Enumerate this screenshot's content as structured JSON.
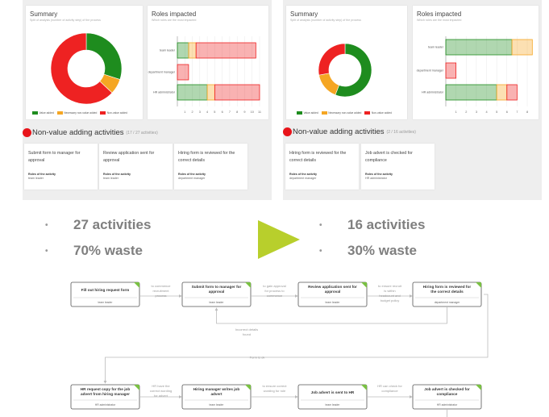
{
  "before": {
    "summary_title": "Summary",
    "summary_sub": "Split of analysis (number of activity step) of the process",
    "roles_title": "Roles impacted",
    "roles_sub": "Which roles are the most impacted",
    "roles": [
      "team leader",
      "department manager",
      "HR administrator"
    ],
    "x_ticks": [
      "1",
      "2",
      "3",
      "4",
      "5",
      "6",
      "7",
      "8",
      "9",
      "10",
      "11"
    ],
    "legend": [
      "Value added",
      "Necessary non-value added",
      "Non-value added"
    ],
    "nva_title": "Non-value adding activities",
    "nva_count": "(17 / 27 activities)",
    "activities": [
      {
        "title": "Submit form to manager for approval",
        "roles_label": "Roles of the activity",
        "role": "team leader"
      },
      {
        "title": "Review application sent for approval",
        "roles_label": "Roles of the activity",
        "role": "team leader"
      },
      {
        "title": "Hiring form is reviewed for the correct details",
        "roles_label": "Roles of the activity",
        "role": "department manager"
      }
    ]
  },
  "after": {
    "summary_title": "Summary",
    "summary_sub": "Split of analysis (number of activity step) of the process",
    "roles_title": "Roles impacted",
    "roles_sub": "Which roles are the most impacted",
    "roles": [
      "team leader",
      "department manager",
      "HR administrator"
    ],
    "x_ticks": [
      "1",
      "2",
      "3",
      "4",
      "5",
      "6",
      "7",
      "8"
    ],
    "legend": [
      "Value added",
      "Necessary non-value added",
      "Non-value added"
    ],
    "nva_title": "Non-value adding activities",
    "nva_count": "(2 / 16 activities)",
    "activities": [
      {
        "title": "Hiring form is reviewed for the correct details",
        "roles_label": "Roles of the activity",
        "role": "department manager"
      },
      {
        "title": "Job advert is checked for compliance",
        "roles_label": "Roles of the activity",
        "role": "HR administrator"
      }
    ]
  },
  "stats": {
    "before": [
      "27 activities",
      "70% waste"
    ],
    "after": [
      "16 activities",
      "30% waste"
    ],
    "bullet": "•"
  },
  "colors": {
    "value_added": "#1e8c1e",
    "necessary_nva": "#f5a623",
    "non_value_added": "#ee2222",
    "arrow": "#b8cf2c",
    "panel_bg": "#eeeeee"
  },
  "flow": {
    "row1": [
      {
        "title": "Fill out hiring request form",
        "role": "team leader"
      },
      {
        "title": "Submit form to manager for approval",
        "role": "team leader"
      },
      {
        "title": "Review application sent for approval",
        "role": "team leader"
      },
      {
        "title": "Hiring form is reviewed for the correct details",
        "role": "department manager"
      }
    ],
    "row1_links": [
      "to commence recruitment process",
      "to gain approval for process to commence",
      "to ensure recruit is within headcount and budget policy"
    ],
    "row2": [
      {
        "title": "HR request copy for the job advert from hiring manager",
        "role": "HR administrator"
      },
      {
        "title": "Hiring manager writes job advert",
        "role": "team leader"
      },
      {
        "title": "Job advert is sent to HR",
        "role": "team leader"
      },
      {
        "title": "Job advert is checked for compliance",
        "role": "HR administrator"
      }
    ],
    "row2_links": [
      "HR have the correct wording for advert",
      "to ensure correct wording for role",
      "HR can check for compliance"
    ],
    "incorrect_label": "Incorrect details found",
    "ok_label": "Form is ok"
  }
}
